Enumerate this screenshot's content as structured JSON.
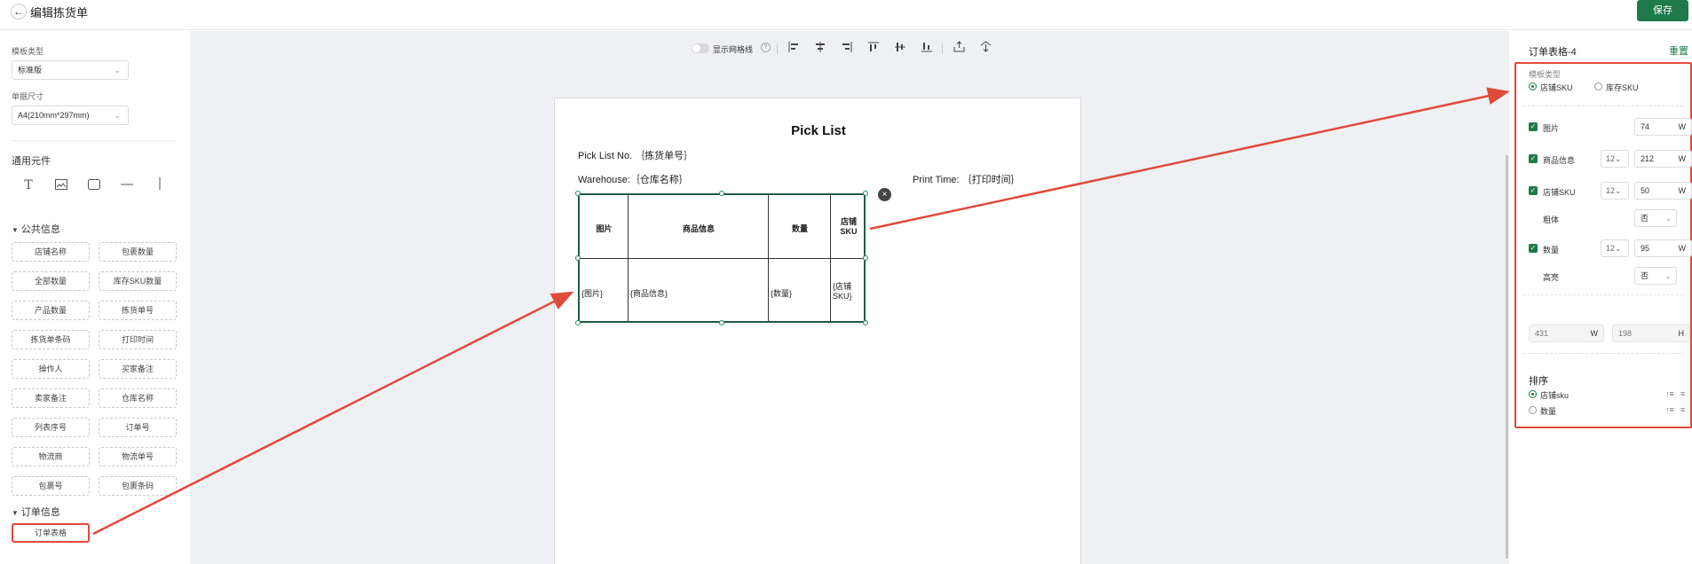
{
  "header": {
    "back_icon": "back-arrow-icon",
    "title": "编辑拣货单",
    "save_label": "保存",
    "accent": "#1f7a4a"
  },
  "left": {
    "template_type": {
      "label": "模板类型",
      "value": "标准版"
    },
    "paper_size": {
      "label": "单据尺寸",
      "value": "A4(210mm*297mm)"
    },
    "common_title": "通用元件",
    "tools": [
      "text-icon",
      "image-icon",
      "rectangle-icon",
      "horizontal-line-icon",
      "vertical-line-icon"
    ],
    "public_title": "公共信息",
    "public_items": [
      "店铺名称",
      "包裹数量",
      "全部数量",
      "库存SKU数量",
      "产品数量",
      "拣货单号",
      "拣货单条码",
      "打印时间",
      "操作人",
      "买家备注",
      "卖家备注",
      "仓库名称",
      "列表序号",
      "订单号",
      "物流商",
      "物流单号",
      "包裹号",
      "包裹条码"
    ],
    "order_title": "订单信息",
    "order_items": [
      "订单表格"
    ]
  },
  "toolbar": {
    "grid_label": "显示网格线",
    "icons": [
      "align-left-icon",
      "align-center-icon",
      "align-right-icon",
      "align-top-icon",
      "align-middle-icon",
      "align-bottom-icon",
      "bring-forward-icon",
      "send-backward-icon"
    ]
  },
  "paper": {
    "title": "Pick List",
    "pick_no": "Pick List No. ｛拣货单号｝",
    "warehouse": "Warehouse:｛仓库名称｝",
    "print_time": "Print Time: ｛打印时间｝",
    "table": {
      "headers": [
        "图片",
        "商品信息",
        "数量",
        "店铺SKU"
      ],
      "cells": [
        "{图片}",
        "{商品信息}",
        "{数量}",
        "{店铺SKU}"
      ]
    }
  },
  "right": {
    "title": "订单表格-4",
    "reset": "重置",
    "template_label": "模板类型",
    "template_options": [
      "店铺SKU",
      "库存SKU"
    ],
    "fields": {
      "image": {
        "label": "图片",
        "width": "74",
        "unit": "W"
      },
      "product": {
        "label": "商品信息",
        "font": "12",
        "width": "212",
        "unit": "W"
      },
      "sku": {
        "label": "店铺SKU",
        "font": "12",
        "width": "50",
        "unit": "W"
      },
      "sku_bold": {
        "label": "粗体",
        "value": "否"
      },
      "qty": {
        "label": "数量",
        "font": "12",
        "width": "95",
        "unit": "W"
      },
      "qty_highlight": {
        "label": "高亮",
        "value": "否"
      }
    },
    "size": {
      "w": "431",
      "w_unit": "W",
      "h": "198",
      "h_unit": "H"
    },
    "sort_title": "排序",
    "sort_options": [
      "店铺sku",
      "数量"
    ]
  },
  "annotation_color": "#e04a3a"
}
